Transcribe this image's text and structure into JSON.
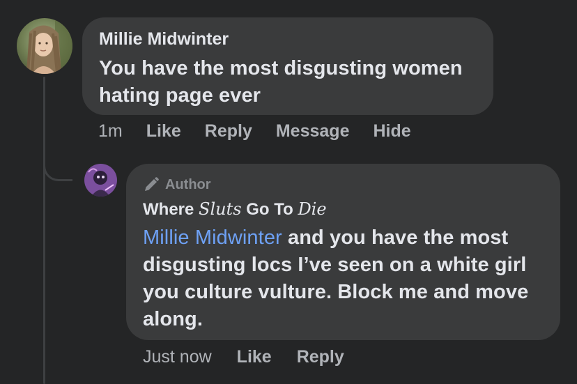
{
  "comment": {
    "author": "Millie Midwinter",
    "text_line1": "You have the most disgusting women",
    "text_line2": "hating page ever",
    "time": "1m",
    "actions": [
      "Like",
      "Reply",
      "Message",
      "Hide"
    ]
  },
  "reply": {
    "badge": "Author",
    "author_part1": "Where ",
    "author_part2": "Sluts",
    "author_part3": " Go To ",
    "author_part4": "Die",
    "mention": "Millie Midwinter",
    "text_line1_rest": " and you have the most",
    "text_line2": "disgusting locs I’ve seen on a white girl",
    "text_line3": "you culture vulture. Block me and move",
    "text_line4": "along.",
    "time": "Just now",
    "actions": [
      "Like",
      "Reply"
    ]
  },
  "colors": {
    "background": "#242526",
    "bubble": "#3a3b3c",
    "mention": "#6ea1f5",
    "secondary_text": "#b0b3b8"
  },
  "icons": {
    "badge_icon": "pencil-icon"
  }
}
